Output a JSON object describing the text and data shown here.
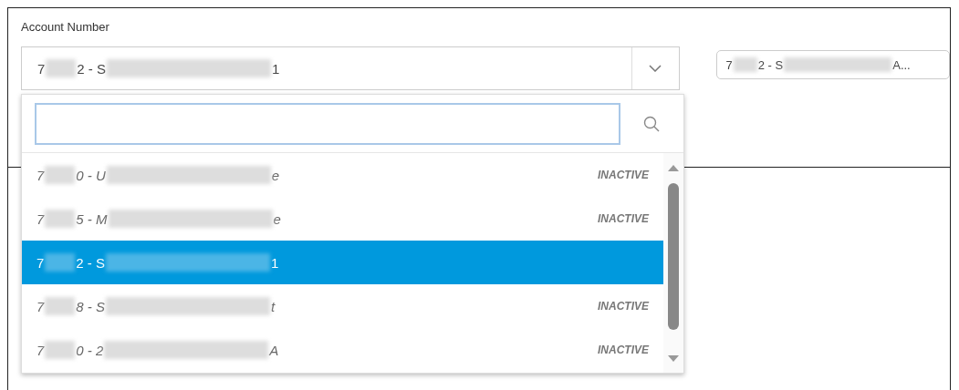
{
  "field": {
    "label": "Account Number",
    "value": [
      {
        "kind": "text",
        "text": "7"
      },
      {
        "kind": "blur"
      },
      {
        "kind": "text",
        "text": "2 - S"
      },
      {
        "kind": "blur"
      },
      {
        "kind": "text",
        "text": "1"
      }
    ],
    "chip": [
      {
        "kind": "text",
        "text": "7"
      },
      {
        "kind": "blur"
      },
      {
        "kind": "text",
        "text": "2 - S"
      },
      {
        "kind": "blur"
      },
      {
        "kind": "text",
        "text": "A..."
      }
    ]
  },
  "dropdown": {
    "options": [
      {
        "selected": false,
        "status": "INACTIVE",
        "segments": [
          {
            "kind": "text",
            "text": "7"
          },
          {
            "kind": "blur"
          },
          {
            "kind": "text",
            "text": "0 - U"
          },
          {
            "kind": "blur"
          },
          {
            "kind": "text",
            "text": "e"
          }
        ]
      },
      {
        "selected": false,
        "status": "INACTIVE",
        "segments": [
          {
            "kind": "text",
            "text": "7"
          },
          {
            "kind": "blur"
          },
          {
            "kind": "text",
            "text": "5 - M"
          },
          {
            "kind": "blur"
          },
          {
            "kind": "text",
            "text": "e"
          }
        ]
      },
      {
        "selected": true,
        "segments": [
          {
            "kind": "text",
            "text": "7"
          },
          {
            "kind": "blur"
          },
          {
            "kind": "text",
            "text": "2 - S"
          },
          {
            "kind": "blur"
          },
          {
            "kind": "text",
            "text": "1"
          }
        ]
      },
      {
        "selected": false,
        "status": "INACTIVE",
        "segments": [
          {
            "kind": "text",
            "text": "7"
          },
          {
            "kind": "blur"
          },
          {
            "kind": "text",
            "text": "8 - S"
          },
          {
            "kind": "blur"
          },
          {
            "kind": "text",
            "text": "t"
          }
        ]
      },
      {
        "selected": false,
        "status": "INACTIVE",
        "segments": [
          {
            "kind": "text",
            "text": "7"
          },
          {
            "kind": "blur"
          },
          {
            "kind": "text",
            "text": "0 - 2"
          },
          {
            "kind": "blur"
          },
          {
            "kind": "text",
            "text": "A"
          }
        ]
      }
    ]
  }
}
